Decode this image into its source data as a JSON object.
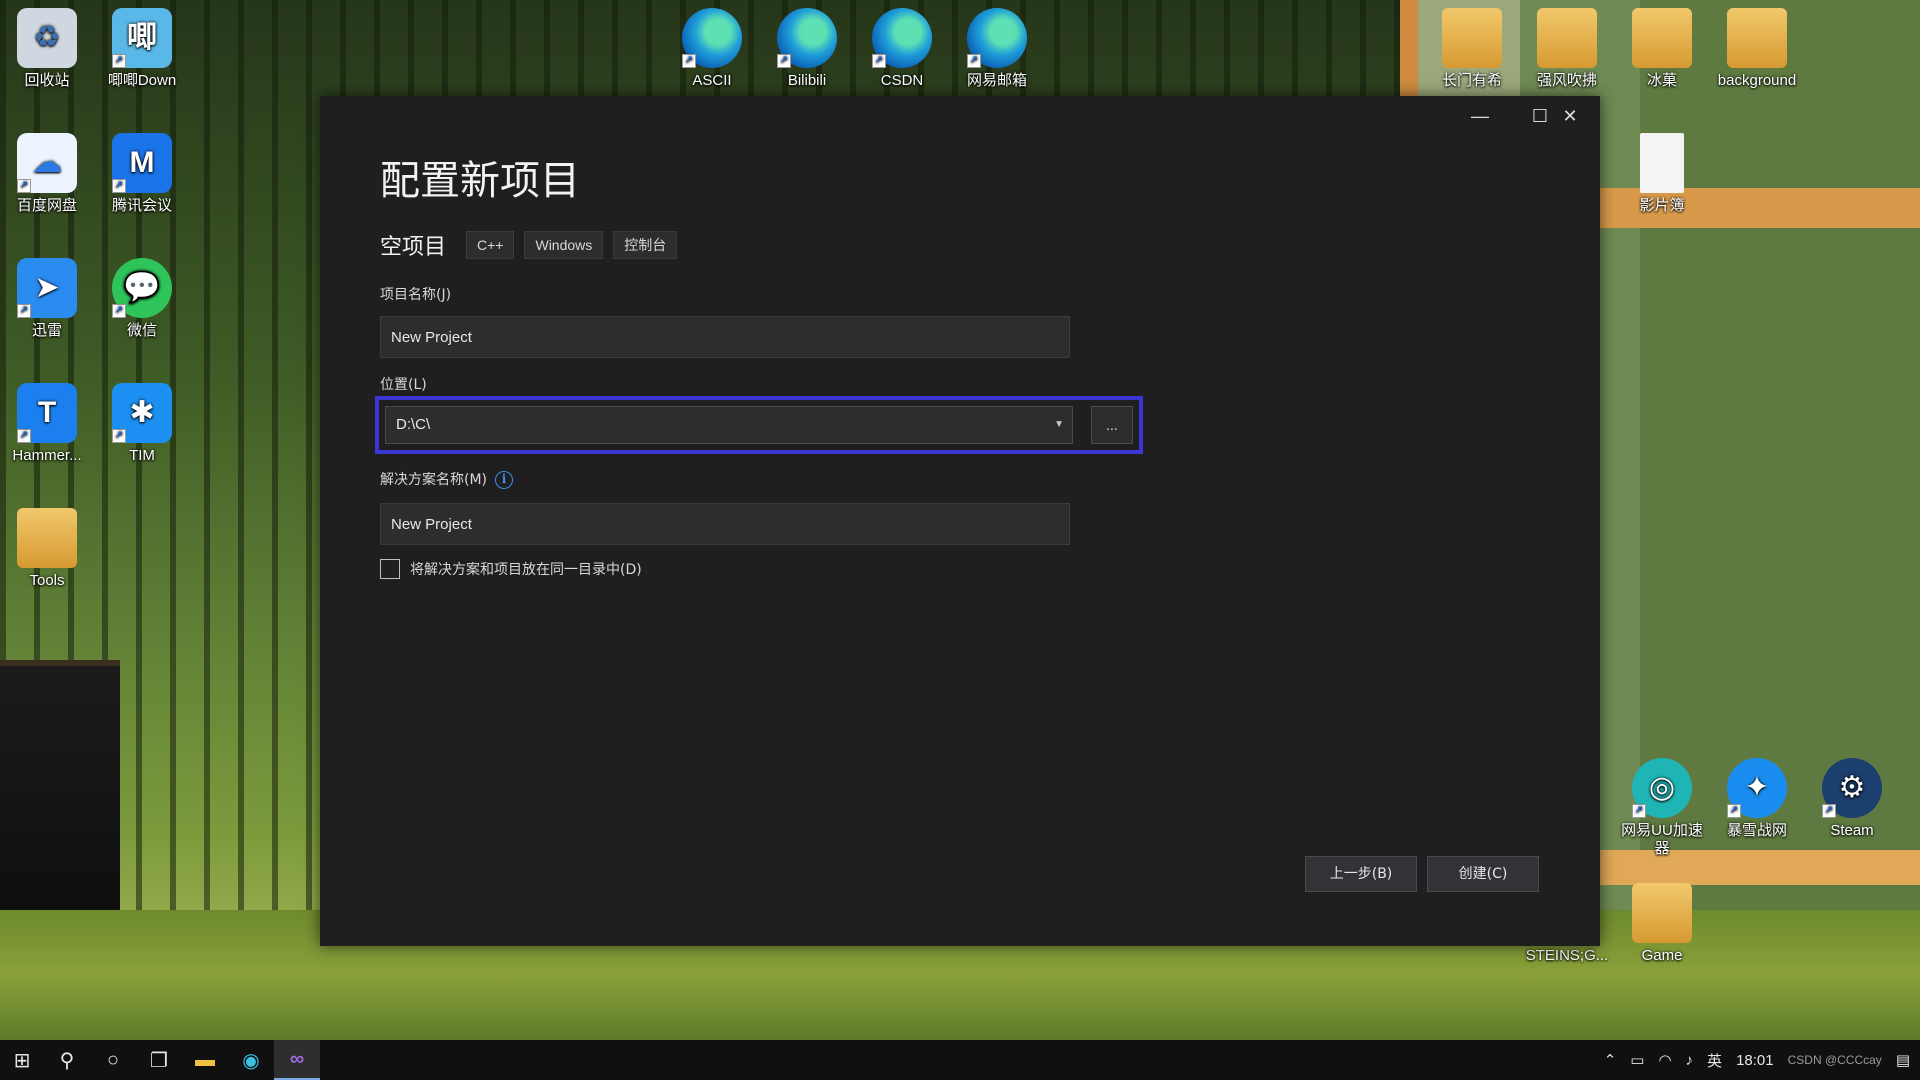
{
  "desktop": {
    "left_icons": [
      {
        "label": "回收站",
        "icon": "recycle-bin-icon",
        "color": "#d9e2ea"
      },
      {
        "label": "唧唧Down",
        "icon": "jijidown-icon",
        "color": "#5ab8e8"
      },
      {
        "label": "百度网盘",
        "icon": "baidu-netdisk-icon",
        "color": "#e9f3ff"
      },
      {
        "label": "腾讯会议",
        "icon": "tencent-meeting-icon",
        "color": "#1a73e8"
      },
      {
        "label": "迅雷",
        "icon": "xunlei-icon",
        "color": "#2a8cf0"
      },
      {
        "label": "微信",
        "icon": "wechat-icon",
        "color": "#2ec45a"
      },
      {
        "label": "Hammer...",
        "icon": "hammer-icon",
        "color": "#1b7ff0"
      },
      {
        "label": "TIM",
        "icon": "tim-icon",
        "color": "#1b90f2"
      },
      {
        "label": "Tools",
        "icon": "folder-icon",
        "color": "#e3b44a"
      }
    ],
    "top_icons": [
      {
        "label": "ASCII",
        "icon": "edge-icon"
      },
      {
        "label": "Bilibili",
        "icon": "edge-icon"
      },
      {
        "label": "CSDN",
        "icon": "edge-icon"
      },
      {
        "label": "网易邮箱",
        "icon": "edge-icon"
      }
    ],
    "right_icons": [
      {
        "label": "长门有希",
        "icon": "folder-icon"
      },
      {
        "label": "强风吹拂",
        "icon": "folder-icon"
      },
      {
        "label": "冰菓",
        "icon": "folder-icon"
      },
      {
        "label": "background",
        "icon": "folder-icon"
      },
      {
        "label": "影片簿",
        "icon": "file-icon"
      },
      {
        "label": "网易UU加速器",
        "icon": "uu-accelerator-icon",
        "color": "#1fb5b5"
      },
      {
        "label": "暴雪战网",
        "icon": "battlenet-icon",
        "color": "#1a8ef0"
      },
      {
        "label": "Steam",
        "icon": "steam-icon",
        "color": "#1b3f6e"
      },
      {
        "label": "STEINS;G...",
        "icon": "folder-icon"
      },
      {
        "label": "Game",
        "icon": "folder-icon"
      }
    ]
  },
  "dialog": {
    "title": "配置新项目",
    "template_name": "空项目",
    "tags": [
      "C++",
      "Windows",
      "控制台"
    ],
    "project_name_label": "项目名称(J)",
    "project_name_value": "New Project",
    "location_label": "位置(L)",
    "location_value": "D:\\C\\",
    "browse_label": "...",
    "solution_name_label": "解决方案名称(M)",
    "solution_name_value": "New Project",
    "same_dir_checkbox_label": "将解决方案和项目放在同一目录中(D)",
    "same_dir_checked": false,
    "back_button": "上一步(B)",
    "create_button": "创建(C)",
    "window_controls": {
      "minimize": "—",
      "maximize": "☐",
      "close": "✕"
    },
    "highlight_color": "#3a37d4"
  },
  "taskbar": {
    "items": [
      {
        "name": "start-button",
        "icon": "windows-logo-icon"
      },
      {
        "name": "search-button",
        "icon": "search-icon"
      },
      {
        "name": "cortana-button",
        "icon": "cortana-icon"
      },
      {
        "name": "task-view-button",
        "icon": "task-view-icon"
      },
      {
        "name": "file-explorer-button",
        "icon": "file-explorer-icon"
      },
      {
        "name": "edge-button",
        "icon": "edge-icon"
      },
      {
        "name": "visual-studio-button",
        "icon": "visual-studio-icon",
        "active": true
      }
    ],
    "tray": {
      "ime": "英",
      "time": "18:01",
      "watermark": "CSDN @CCCcay"
    }
  }
}
